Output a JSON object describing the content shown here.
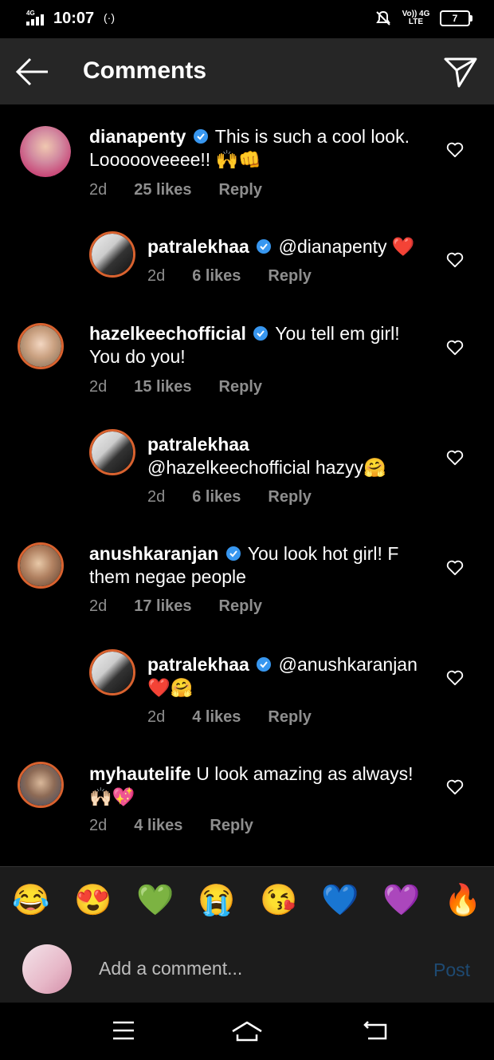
{
  "status_bar": {
    "time": "10:07",
    "signal_label": "4G",
    "network_label": "Vo)) 4G LTE",
    "battery": "7"
  },
  "header": {
    "title": "Comments"
  },
  "comments": [
    {
      "username": "dianapenty",
      "verified": true,
      "text": "This is such a cool look. Loooooveeee!! 🙌👊",
      "age": "2d",
      "likes": "25 likes",
      "reply": "Reply"
    },
    {
      "username": "patralekhaa",
      "verified": true,
      "text": "@dianapenty ❤️",
      "age": "2d",
      "likes": "6 likes",
      "reply": "Reply"
    },
    {
      "username": "hazelkeechofficial",
      "verified": true,
      "text": "You tell em girl! You do you!",
      "age": "2d",
      "likes": "15 likes",
      "reply": "Reply"
    },
    {
      "username": "patralekhaa",
      "verified": false,
      "text": "@hazelkeechofficial hazyy🤗",
      "age": "2d",
      "likes": "6 likes",
      "reply": "Reply"
    },
    {
      "username": "anushkaranjan",
      "verified": true,
      "text": "You look hot girl! F them negae people",
      "age": "2d",
      "likes": "17 likes",
      "reply": "Reply"
    },
    {
      "username": "patralekhaa",
      "verified": true,
      "text": "@anushkaranjan ❤️🤗",
      "age": "2d",
      "likes": "4 likes",
      "reply": "Reply"
    },
    {
      "username": "myhautelife",
      "verified": false,
      "text": "U look amazing as always! 🙌🏻💖",
      "age": "2d",
      "likes": "4 likes",
      "reply": "Reply"
    }
  ],
  "emoji_bar": [
    "😂",
    "😍",
    "💚",
    "😭",
    "😘",
    "💙",
    "💜",
    "🔥"
  ],
  "composer": {
    "placeholder": "Add a comment...",
    "post_label": "Post"
  },
  "colors": {
    "background": "#000000",
    "header": "#262626",
    "meta_text": "#8e8e8e",
    "verified_blue": "#3897f0",
    "story_ring": "#d9622f",
    "post_disabled": "#1e4a72"
  }
}
